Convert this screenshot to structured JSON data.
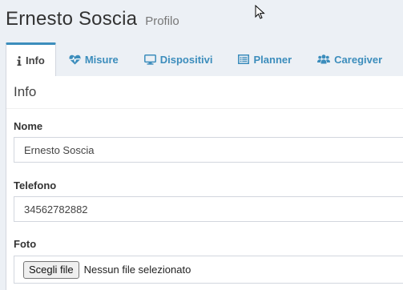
{
  "header": {
    "title": "Ernesto Soscia",
    "subtitle": "Profilo"
  },
  "tabs": [
    {
      "label": "Info",
      "icon": "info-icon",
      "active": true
    },
    {
      "label": "Misure",
      "icon": "heartbeat-icon",
      "active": false
    },
    {
      "label": "Dispositivi",
      "icon": "desktop-icon",
      "active": false
    },
    {
      "label": "Planner",
      "icon": "list-icon",
      "active": false
    },
    {
      "label": "Caregiver",
      "icon": "users-icon",
      "active": false
    }
  ],
  "card": {
    "title": "Info"
  },
  "form": {
    "nome": {
      "label": "Nome",
      "value": "Ernesto Soscia"
    },
    "telefono": {
      "label": "Telefono",
      "value": "34562782882"
    },
    "foto": {
      "label": "Foto",
      "button_label": "Scegli file",
      "status": "Nessun file selezionato"
    }
  },
  "colors": {
    "accent": "#3c8dbc",
    "background": "#ecf0f5",
    "card": "#ffffff"
  }
}
